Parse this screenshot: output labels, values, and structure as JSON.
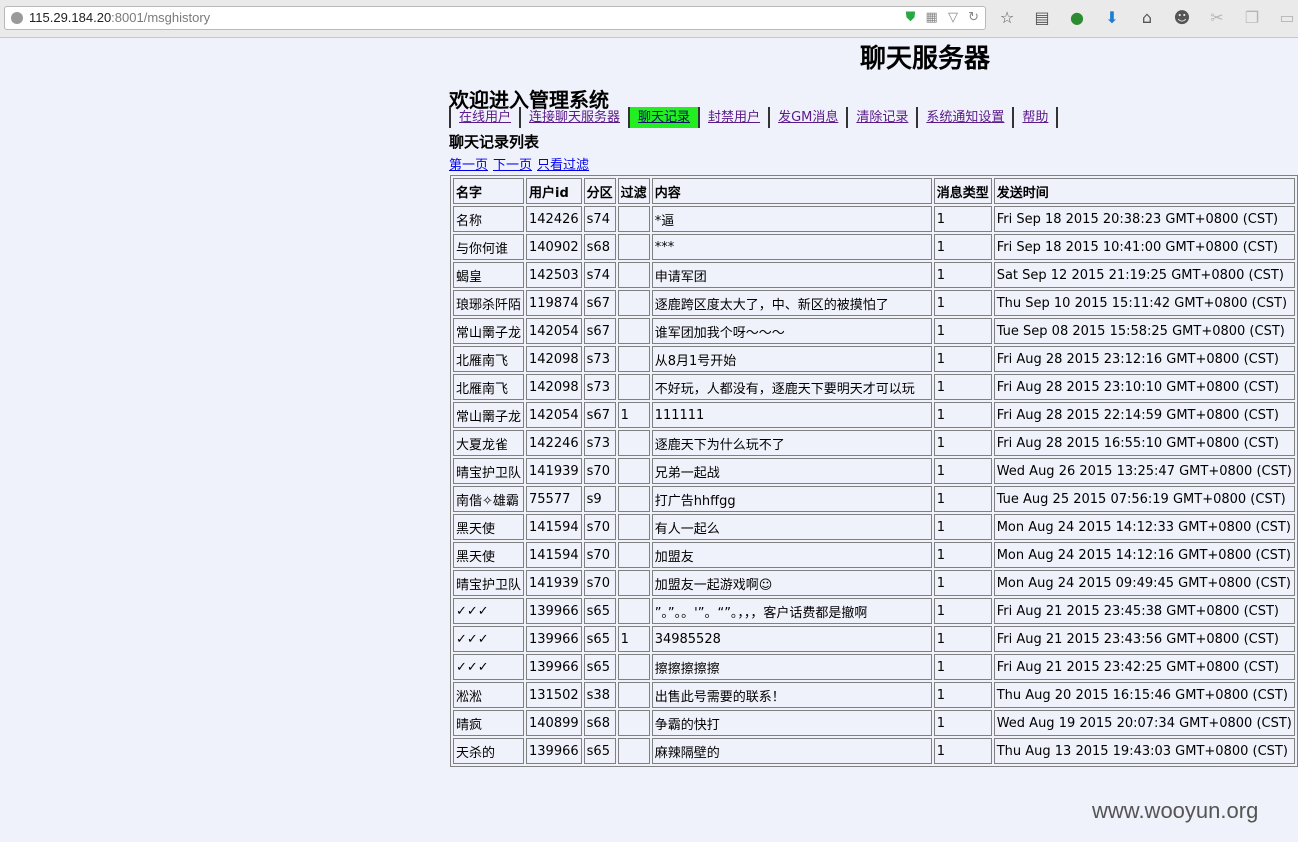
{
  "browser": {
    "url_host": "115.29.184.20",
    "url_rest": ":8001/msghistory",
    "icons": [
      "shield-icon",
      "qr-icon",
      "dropdown-icon",
      "reload-icon",
      "bookmark-star-icon",
      "reader-icon",
      "extension-icon",
      "download-icon",
      "home-icon",
      "chat-icon",
      "cut-icon",
      "copy-icon",
      "clipboard-icon"
    ]
  },
  "header": {
    "server_title": "聊天服务器",
    "welcome": "欢迎进入管理系统"
  },
  "nav": {
    "items": [
      "在线用户",
      "连接聊天服务器",
      "聊天记录",
      "封禁用户",
      "发GM消息",
      "清除记录",
      "系统通知设置",
      "帮助"
    ],
    "active_index": 2,
    "active_color": "#22ee22"
  },
  "list": {
    "title": "聊天记录列表",
    "pager": [
      "第一页",
      "下一页",
      "只看过滤"
    ]
  },
  "table": {
    "columns": [
      "名字",
      "用户id",
      "分区",
      "过滤",
      "内容",
      "消息类型",
      "发送时间"
    ],
    "rows": [
      [
        "名称",
        "142426",
        "s74",
        "",
        "*逼",
        "1",
        "Fri Sep 18 2015 20:38:23 GMT+0800 (CST)"
      ],
      [
        "与你何谁",
        "140902",
        "s68",
        "",
        "***",
        "1",
        "Fri Sep 18 2015 10:41:00 GMT+0800 (CST)"
      ],
      [
        "蝎皇",
        "142503",
        "s74",
        "",
        "申请军团",
        "1",
        "Sat Sep 12 2015 21:19:25 GMT+0800 (CST)"
      ],
      [
        "琅琊杀阡陌",
        "119874",
        "s67",
        "",
        "逐鹿跨区度太大了，中、新区的被摸怕了",
        "1",
        "Thu Sep 10 2015 15:11:42 GMT+0800 (CST)"
      ],
      [
        "常山罱子龙",
        "142054",
        "s67",
        "",
        "谁军团加我个呀～～～",
        "1",
        "Tue Sep 08 2015 15:58:25 GMT+0800 (CST)"
      ],
      [
        "北雁南飞",
        "142098",
        "s73",
        "",
        "从8月1号开始",
        "1",
        "Fri Aug 28 2015 23:12:16 GMT+0800 (CST)"
      ],
      [
        "北雁南飞",
        "142098",
        "s73",
        "",
        "不好玩，人都没有，逐鹿天下要明天才可以玩",
        "1",
        "Fri Aug 28 2015 23:10:10 GMT+0800 (CST)"
      ],
      [
        "常山罱子龙",
        "142054",
        "s67",
        "1",
        "111111",
        "1",
        "Fri Aug 28 2015 22:14:59 GMT+0800 (CST)"
      ],
      [
        "大夏龙雀",
        "142246",
        "s73",
        "",
        "逐鹿天下为什么玩不了",
        "1",
        "Fri Aug 28 2015 16:55:10 GMT+0800 (CST)"
      ],
      [
        "晴宝护卫队",
        "141939",
        "s70",
        "",
        "兄弟一起战",
        "1",
        "Wed Aug 26 2015 13:25:47 GMT+0800 (CST)"
      ],
      [
        "南偕✧雄霸",
        "75577",
        "s9",
        "",
        "打广告hhffgg",
        "1",
        "Tue Aug 25 2015 07:56:19 GMT+0800 (CST)"
      ],
      [
        "黑天使",
        "141594",
        "s70",
        "",
        "有人一起么",
        "1",
        "Mon Aug 24 2015 14:12:33 GMT+0800 (CST)"
      ],
      [
        "黑天使",
        "141594",
        "s70",
        "",
        "加盟友",
        "1",
        "Mon Aug 24 2015 14:12:16 GMT+0800 (CST)"
      ],
      [
        "晴宝护卫队",
        "141939",
        "s70",
        "",
        "加盟友一起游戏啊☺",
        "1",
        "Mon Aug 24 2015 09:49:45 GMT+0800 (CST)"
      ],
      [
        "✓✓✓",
        "139966",
        "s65",
        "",
        "”。”。。'”。“”。，，，客户话费都是撤啊",
        "1",
        "Fri Aug 21 2015 23:45:38 GMT+0800 (CST)"
      ],
      [
        "✓✓✓",
        "139966",
        "s65",
        "1",
        "34985528",
        "1",
        "Fri Aug 21 2015 23:43:56 GMT+0800 (CST)"
      ],
      [
        "✓✓✓",
        "139966",
        "s65",
        "",
        "擦擦擦擦擦",
        "1",
        "Fri Aug 21 2015 23:42:25 GMT+0800 (CST)"
      ],
      [
        "淞淞",
        "131502",
        "s38",
        "",
        "出售此号需要的联系！",
        "1",
        "Thu Aug 20 2015 16:15:46 GMT+0800 (CST)"
      ],
      [
        "晴疯",
        "140899",
        "s68",
        "",
        "争霸的快打",
        "1",
        "Wed Aug 19 2015 20:07:34 GMT+0800 (CST)"
      ],
      [
        "天杀的",
        "139966",
        "s65",
        "",
        "麻辣隔壁的",
        "1",
        "Thu Aug 13 2015 19:43:03 GMT+0800 (CST)"
      ]
    ]
  },
  "watermark": "www.wooyun.org"
}
